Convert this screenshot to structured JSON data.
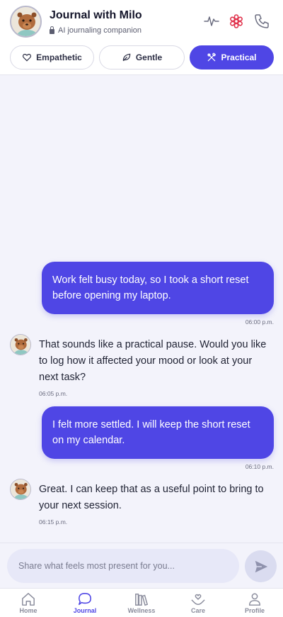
{
  "header": {
    "title": "Journal with Milo",
    "subtitle": "AI journaling companion",
    "icons": [
      "activity-icon",
      "asterisk-icon",
      "phone-icon"
    ],
    "accent_red": "#e0314b"
  },
  "modes": [
    {
      "label": "Empathetic",
      "icon": "heart-icon",
      "active": false
    },
    {
      "label": "Gentle",
      "icon": "leaf-icon",
      "active": false
    },
    {
      "label": "Practical",
      "icon": "tools-icon",
      "active": true
    }
  ],
  "messages": [
    {
      "role": "user",
      "text": "Work felt busy today, so I took a short reset before opening my laptop.",
      "time": "06:00 p.m."
    },
    {
      "role": "bot",
      "text": "That sounds like a practical pause. Would you like to log how it affected your mood or look at your next task?",
      "time": "06:05 p.m."
    },
    {
      "role": "user",
      "text": "I felt more settled. I will keep the short reset on my calendar.",
      "time": "06:10 p.m."
    },
    {
      "role": "bot",
      "text": "Great. I can keep that as a useful point to bring to your next session.",
      "time": "06:15 p.m."
    }
  ],
  "composer": {
    "placeholder": "Share what feels most present for you..."
  },
  "nav": [
    {
      "label": "Home",
      "icon": "home-icon",
      "active": false
    },
    {
      "label": "Journal",
      "icon": "chat-icon",
      "active": true
    },
    {
      "label": "Wellness",
      "icon": "books-icon",
      "active": false
    },
    {
      "label": "Care",
      "icon": "care-hands-icon",
      "active": false
    },
    {
      "label": "Profile",
      "icon": "person-icon",
      "active": false
    }
  ],
  "colors": {
    "accent": "#4f46e5",
    "background": "#f3f3fb"
  }
}
